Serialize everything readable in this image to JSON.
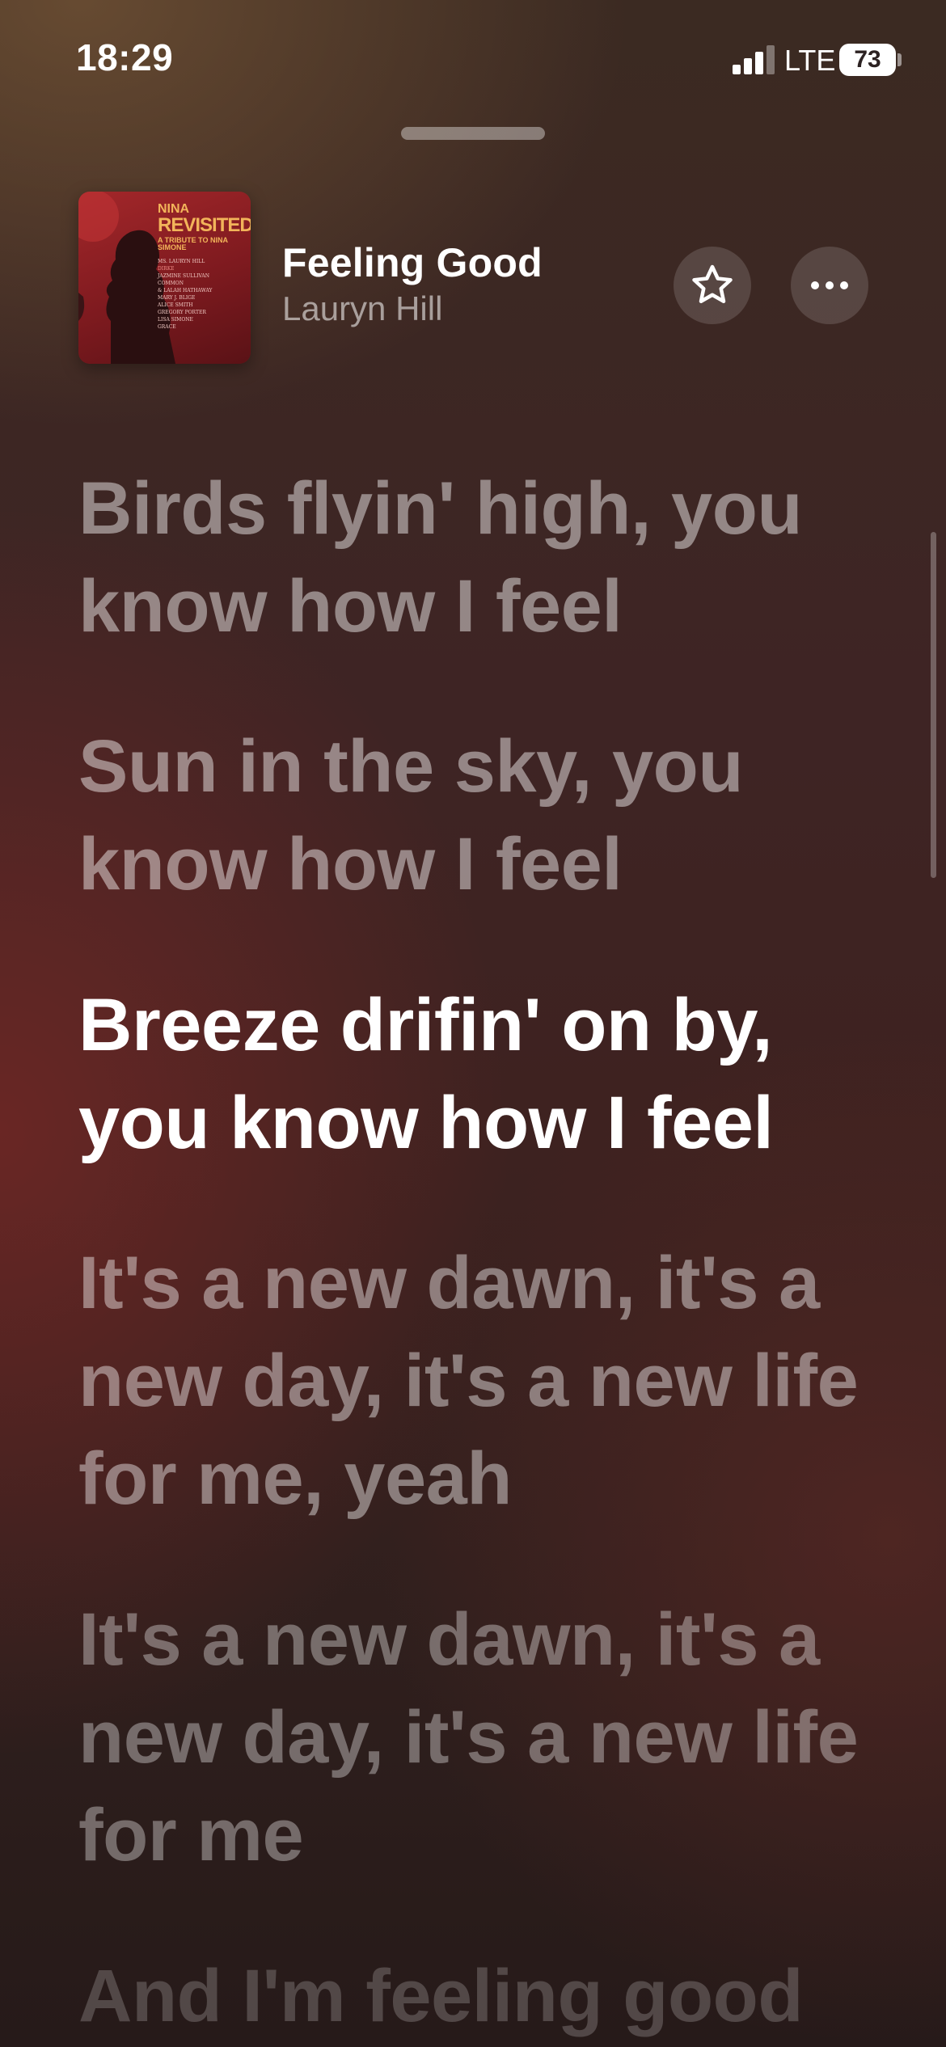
{
  "status_bar": {
    "time": "18:29",
    "network": "LTE",
    "battery": "73",
    "icons": [
      "cellular-signal-icon",
      "battery-icon"
    ]
  },
  "now_playing": {
    "title": "Feeling Good",
    "artist": "Lauryn Hill",
    "artwork": {
      "title_line1": "NINA",
      "title_line2": "REVISITED...",
      "subtitle": "A TRIBUTE TO NINA SIMONE",
      "credits": [
        "MS. LAURYN HILL",
        "DIRKE",
        "JAZMINE SULLIVAN",
        "COMMON",
        "& LALAH HATHAWAY",
        "MARY J. BLIGE",
        "ALICE SMITH",
        "GREGORY PORTER",
        "LISA SIMONE",
        "GRACE"
      ]
    },
    "star_icon": "star-outline-icon",
    "more_icon": "ellipsis-icon"
  },
  "lyrics": [
    "Birds flyin' high, you know how I feel",
    "Sun in the sky, you know how I feel",
    "Breeze drifin' on by, you know how I feel",
    "It's a new dawn, it's a new day, it's a new life for me, yeah",
    "It's a new dawn, it's a new day, it's a new life for me",
    "And I'm feeling good"
  ],
  "current_lyric_index": 2,
  "colors": {
    "active_lyric": "#ffffff",
    "inactive_lyric": "rgba(255,255,255,0.45)",
    "artwork_red": "#a3272a",
    "artwork_gold": "#f2b45a"
  }
}
